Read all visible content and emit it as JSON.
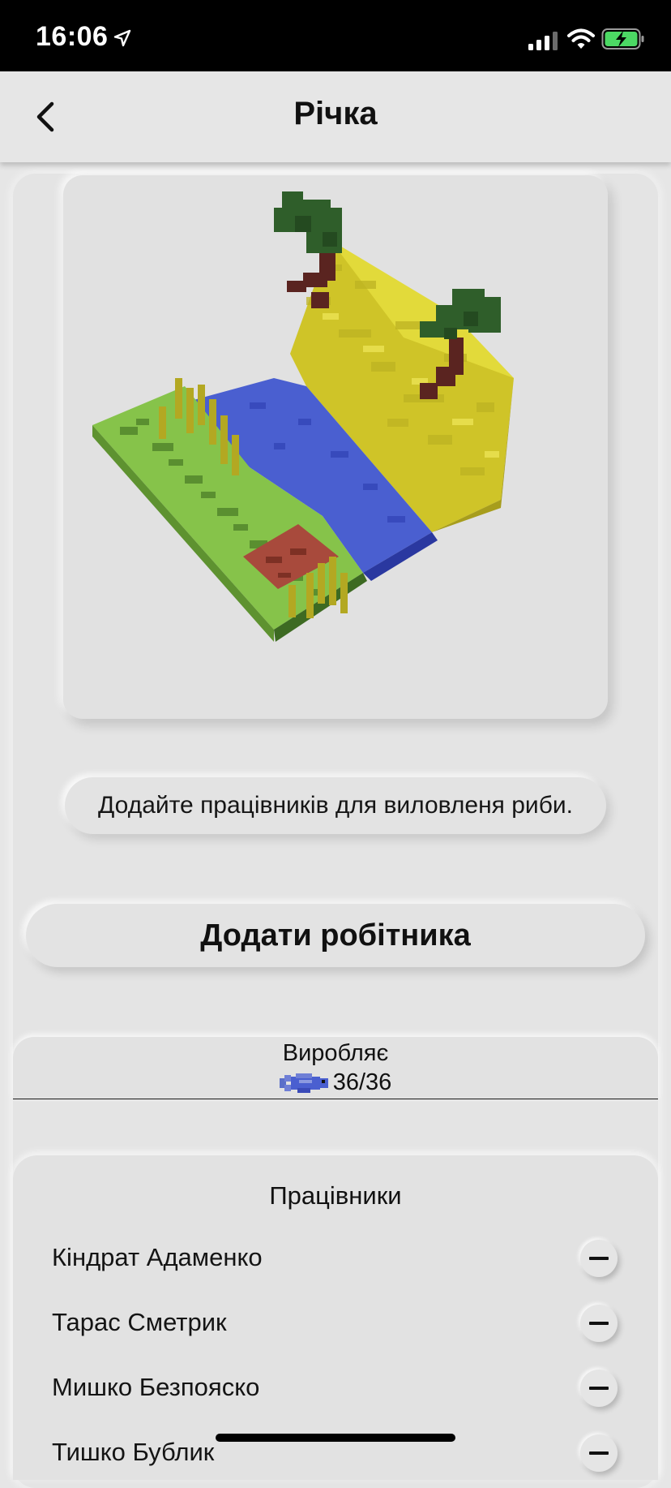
{
  "status_bar": {
    "time": "16:06",
    "icons": [
      "location-arrow-icon",
      "cellular-signal-icon",
      "wifi-icon",
      "battery-charging-icon"
    ],
    "battery_color": "#4cd964"
  },
  "nav": {
    "title": "Річка",
    "back_icon": "chevron-left-icon"
  },
  "scene": {
    "description_icon": "voxel-river-scene"
  },
  "hint_text": "Додайте працівників для виловленя риби.",
  "add_worker_label": "Додати робітника",
  "production": {
    "label": "Виробляє",
    "resource_icon": "fish-icon",
    "amount": "36/36"
  },
  "workers": {
    "title": "Працівники",
    "list": [
      {
        "name": "Кіндрат Адаменко"
      },
      {
        "name": "Тарас Сметрик"
      },
      {
        "name": "Мишко Безпояско"
      },
      {
        "name": "Тишко Бублик"
      }
    ],
    "remove_icon": "minus-icon"
  },
  "colors": {
    "background": "#e6e6e6",
    "grass": "#86c34a",
    "water": "#4a5fd0",
    "sand": "#d9d12c",
    "leaves": "#2f5e2a",
    "trunk": "#5a2420",
    "bridge": "#a84a3c"
  }
}
